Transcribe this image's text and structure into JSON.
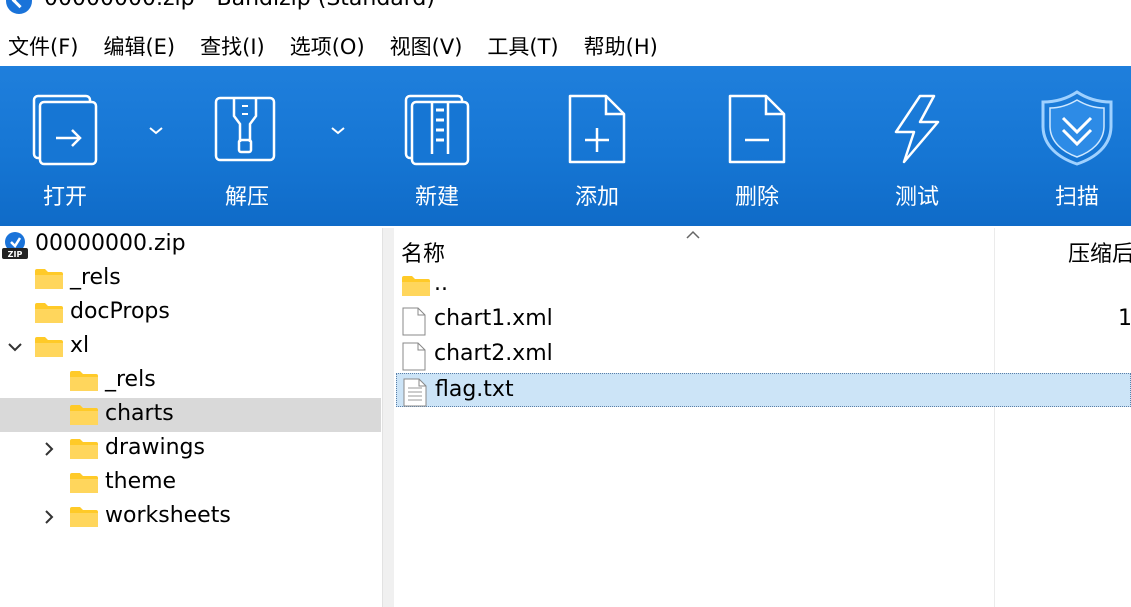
{
  "window": {
    "title": "00000000.zip - Bandizip (Standard)"
  },
  "menu": [
    {
      "label": "文件(F)"
    },
    {
      "label": "编辑(E)"
    },
    {
      "label": "查找(I)"
    },
    {
      "label": "选项(O)"
    },
    {
      "label": "视图(V)"
    },
    {
      "label": "工具(T)"
    },
    {
      "label": "帮助(H)"
    }
  ],
  "toolbar": {
    "open": {
      "label": "打开",
      "icon": "open-archive-icon"
    },
    "extract": {
      "label": "解压",
      "icon": "extract-zip-icon"
    },
    "new": {
      "label": "新建",
      "icon": "new-archive-icon"
    },
    "add": {
      "label": "添加",
      "icon": "add-file-icon"
    },
    "delete": {
      "label": "删除",
      "icon": "delete-file-icon"
    },
    "test": {
      "label": "测试",
      "icon": "lightning-test-icon"
    },
    "scan": {
      "label": "扫描",
      "icon": "shield-scan-icon"
    },
    "background": "#1676d4"
  },
  "tree": {
    "root": "00000000.zip",
    "items": [
      {
        "label": "_rels"
      },
      {
        "label": "docProps"
      },
      {
        "label": "xl"
      },
      {
        "label": "_rels"
      },
      {
        "label": "charts"
      },
      {
        "label": "drawings"
      },
      {
        "label": "theme"
      },
      {
        "label": "worksheets"
      }
    ]
  },
  "list": {
    "columns": {
      "name": "名称",
      "packed": "压缩后"
    },
    "rows": [
      {
        "name": "..",
        "type": "folder"
      },
      {
        "name": "chart1.xml",
        "type": "file",
        "size": "1"
      },
      {
        "name": "chart2.xml",
        "type": "file",
        "size": ""
      },
      {
        "name": "flag.txt",
        "type": "text",
        "size": ""
      }
    ]
  },
  "colors": {
    "toolbar": "#1676d4",
    "tree_selected": "#d9d9d9",
    "list_selected": "#cce4f7",
    "folder": "#ffca28"
  }
}
